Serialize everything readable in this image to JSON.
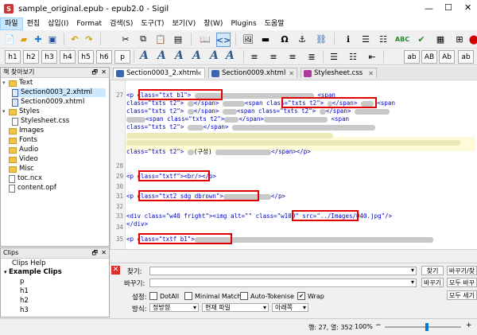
{
  "window": {
    "title": "sample_original.epub - epub2.0 - Sigil"
  },
  "menu": [
    "파일",
    "편집",
    "삽입(I)",
    "Format",
    "검색(S)",
    "도구(T)",
    "보기(V)",
    "창(W)",
    "Plugins",
    "도움말"
  ],
  "toolbar2": {
    "headings": [
      "h1",
      "h2",
      "h3",
      "h4",
      "h5",
      "h6",
      "p"
    ],
    "text_styles": [
      "ab",
      "AB",
      "Ab",
      "ab"
    ]
  },
  "book_browser": {
    "title": "책 찾아보기",
    "items": [
      {
        "label": "Text",
        "type": "folder",
        "expanded": true
      },
      {
        "label": "Section0003_2.xhtml",
        "type": "file",
        "selected": true
      },
      {
        "label": "Section0009.xhtml",
        "type": "file"
      },
      {
        "label": "Styles",
        "type": "folder",
        "expanded": true
      },
      {
        "label": "Stylesheet.css",
        "type": "file"
      },
      {
        "label": "Images",
        "type": "folder"
      },
      {
        "label": "Fonts",
        "type": "folder"
      },
      {
        "label": "Audio",
        "type": "folder"
      },
      {
        "label": "Video",
        "type": "folder"
      },
      {
        "label": "Misc",
        "type": "folder"
      },
      {
        "label": "toc.ncx",
        "type": "file"
      },
      {
        "label": "content.opf",
        "type": "file"
      }
    ]
  },
  "clips": {
    "title": "Clips",
    "items": [
      "Clips Help",
      "Example Clips",
      "p",
      "h1",
      "h2",
      "h3"
    ]
  },
  "tabs": [
    {
      "label": "Section0003_2.xhtml",
      "active": true
    },
    {
      "label": "Section0009.xhtml",
      "active": false
    },
    {
      "label": "Stylesheet.css",
      "active": false
    }
  ],
  "code": {
    "line_numbers": [
      "27",
      "28",
      "29",
      "30",
      "31",
      "32",
      "33",
      "34",
      "35"
    ],
    "l27_tag": "<p class=\"txt b1\">",
    "l27_tail_open": "<span",
    "l27b_cls": "class=\"txts t2\">",
    "l27b_close": "</span>",
    "l27b_span": "<span class=\"txts t2\">",
    "l27b_close2": "</span>",
    "l27b_tail": "<span",
    "l27c_cls": "class=\"txts t2\">",
    "l27c_close": "</span>",
    "l27c_span": "<span class=\"txts t2\">",
    "l27c_close2": "</span>",
    "l27d_span": "<span class=\"txts t2\">",
    "l27d_close": "</span>",
    "l27d_span2": "<span",
    "l27e_cls": "class=\"txts t2\">",
    "l27e_close": "</span>",
    "l27f_cls": "class=\"txts t2\">",
    "l27f_text": "(구성)",
    "l27f_close": "</span></p>",
    "l29_tag": "<p class=\"txtf\">",
    "l29_tail": "<br/></p>",
    "l31_tag": "<p class=\"txt2 sdg dbrown\">",
    "l31_tail": "</p>",
    "l33_a": "<div class=\"w40 fright\"><img alt=\"\"",
    "l33_cls": "class=\"w100\"",
    "l33_b": " src=\"../Images/040.jpg\"/>",
    "l33_c": "</div>",
    "l35_tag": "<p class=\"txtf b1\">"
  },
  "find": {
    "find_label": "찾기:",
    "replace_label": "바꾸기:",
    "mode_label": "설정:",
    "direction_label": "방식:",
    "find_btn": "찾기",
    "replace_find_btn": "바꾸기/찾기",
    "replace_btn": "바꾸기",
    "replace_all_btn": "모두 바꾸기",
    "count_btn": "모두 세기",
    "dotall": "DotAll",
    "minimal": "Minimal Match",
    "autotoken": "Auto-Tokenise",
    "wrap": "Wrap",
    "wrap_checked": true,
    "mode_value": "정방향",
    "scope_value": "현재 파일",
    "dir_value": "아래쪽"
  },
  "status": {
    "position": "행: 27, 열: 352",
    "zoom": "100%",
    "zoom_level": 0.55
  }
}
